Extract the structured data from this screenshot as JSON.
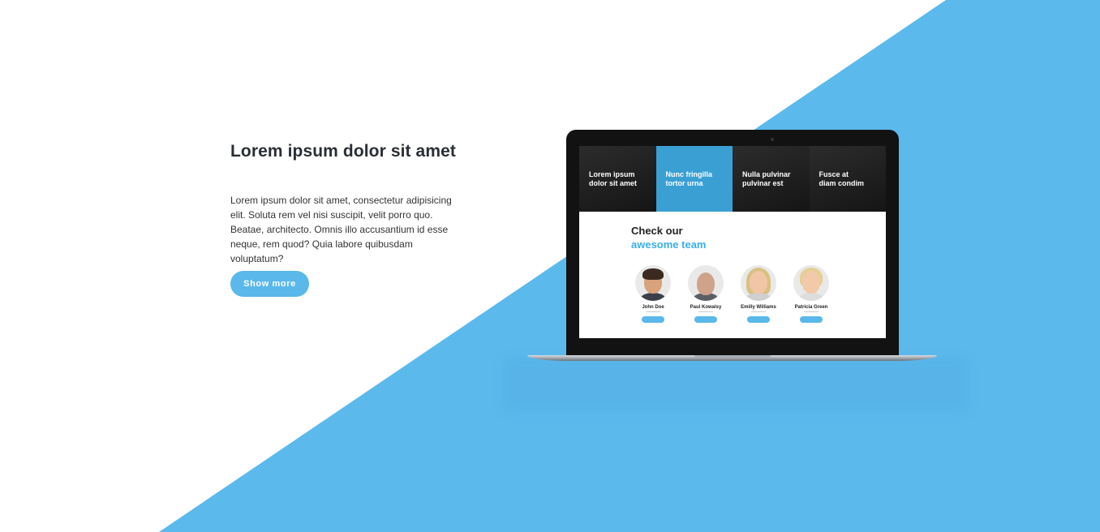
{
  "colors": {
    "accent": "#5BB9EB",
    "accent_dark": "#3AA0D4",
    "heading": "#2A2F36",
    "body_text": "#333333"
  },
  "section": {
    "heading": "Lorem ipsum dolor sit amet",
    "paragraph": "Lorem ipsum dolor sit amet, consectetur adipisicing elit. Soluta rem vel nisi suscipit, velit porro quo. Beatae, architecto. Omnis illo accusantium id esse neque, rem quod? Quia labore quibusdam voluptatum?",
    "button_label": "Show more"
  },
  "laptop_screen": {
    "hero_items": [
      {
        "line1": "Lorem ipsum",
        "line2": "dolor sit amet"
      },
      {
        "line1": "Nunc fringilla",
        "line2": "tortor urna"
      },
      {
        "line1": "Nulla pulvinar",
        "line2": "pulvinar est"
      },
      {
        "line1": "Fusce at",
        "line2": "diam condim"
      }
    ],
    "team_title_line1": "Check our",
    "team_title_line2": "awesome team",
    "members": [
      {
        "name": "John Doe"
      },
      {
        "name": "Paul Kowalsy"
      },
      {
        "name": "Emilly Williams"
      },
      {
        "name": "Patricia Green"
      }
    ]
  }
}
